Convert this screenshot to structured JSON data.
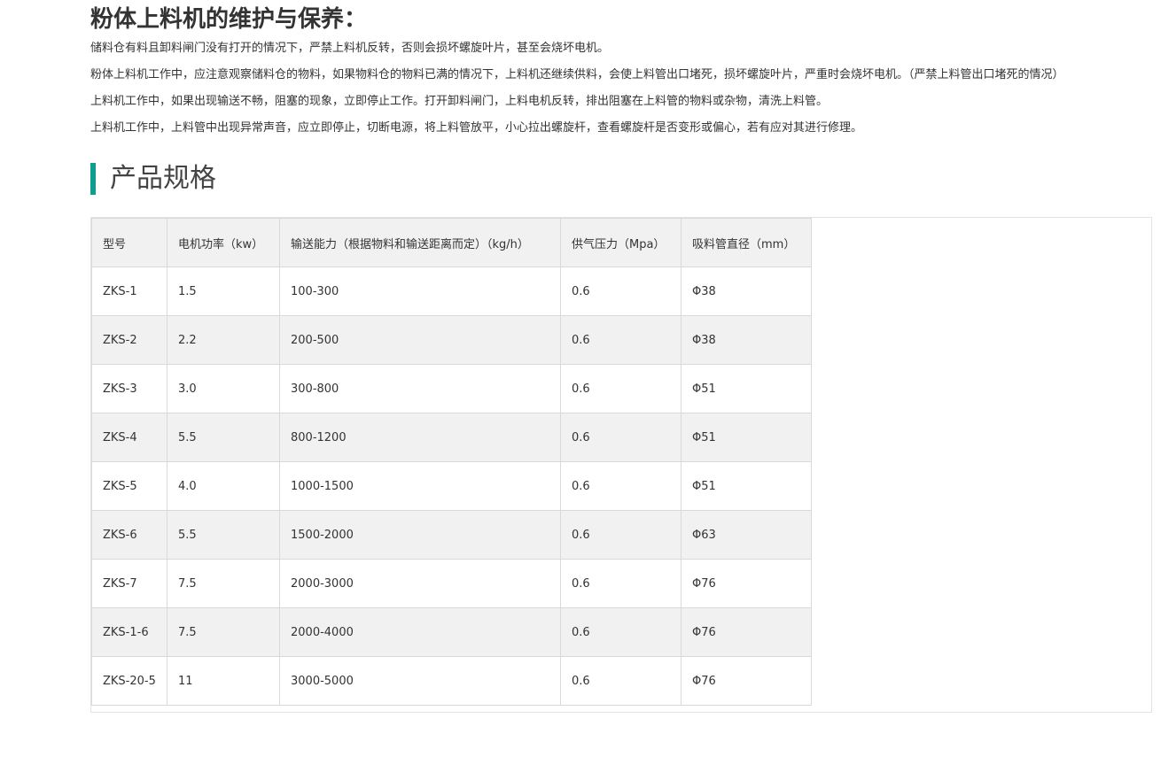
{
  "maintenance": {
    "title": "粉体上料机的维护与保养：",
    "paragraphs": [
      "储料仓有料且卸料闸门没有打开的情况下，严禁上料机反转，否则会损坏螺旋叶片，甚至会烧坏电机。",
      "粉体上料机工作中，应注意观察储料仓的物料，如果物料仓的物料已满的情况下，上料机还继续供料，会使上料管出口堵死，损坏螺旋叶片，严重时会烧坏电机。（严禁上料管出口堵死的情况）",
      "上料机工作中，如果出现输送不畅，阻塞的现象，立即停止工作。打开卸料闸门，上料电机反转，排出阻塞在上料管的物料或杂物，清洗上料管。",
      "上料机工作中，上料管中出现异常声音，应立即停止，切断电源，将上料管放平，小心拉出螺旋杆，查看螺旋杆是否变形或偏心，若有应对其进行修理。"
    ]
  },
  "specs": {
    "title": "产品规格",
    "accent_color": "#0f9d8f",
    "header": [
      "型号",
      "电机功率（kw）",
      "输送能力（根据物料和输送距离而定）（kg/h）",
      "供气压力（Mpa）",
      "吸料管直径（mm）"
    ],
    "rows": [
      [
        "ZKS-1",
        "1.5",
        "100-300",
        "0.6",
        "Φ38"
      ],
      [
        "ZKS-2",
        "2.2",
        "200-500",
        "0.6",
        "Φ38"
      ],
      [
        "ZKS-3",
        "3.0",
        "300-800",
        "0.6",
        "Φ51"
      ],
      [
        "ZKS-4",
        "5.5",
        "800-1200",
        "0.6",
        "Φ51"
      ],
      [
        "ZKS-5",
        "4.0",
        "1000-1500",
        "0.6",
        "Φ51"
      ],
      [
        "ZKS-6",
        "5.5",
        "1500-2000",
        "0.6",
        "Φ63"
      ],
      [
        "ZKS-7",
        "7.5",
        "2000-3000",
        "0.6",
        "Φ76"
      ],
      [
        "ZKS-1-6",
        "7.5",
        "2000-4000",
        "0.6",
        "Φ76"
      ],
      [
        "ZKS-20-5",
        "11",
        "3000-5000",
        "0.6",
        "Φ76"
      ]
    ]
  }
}
